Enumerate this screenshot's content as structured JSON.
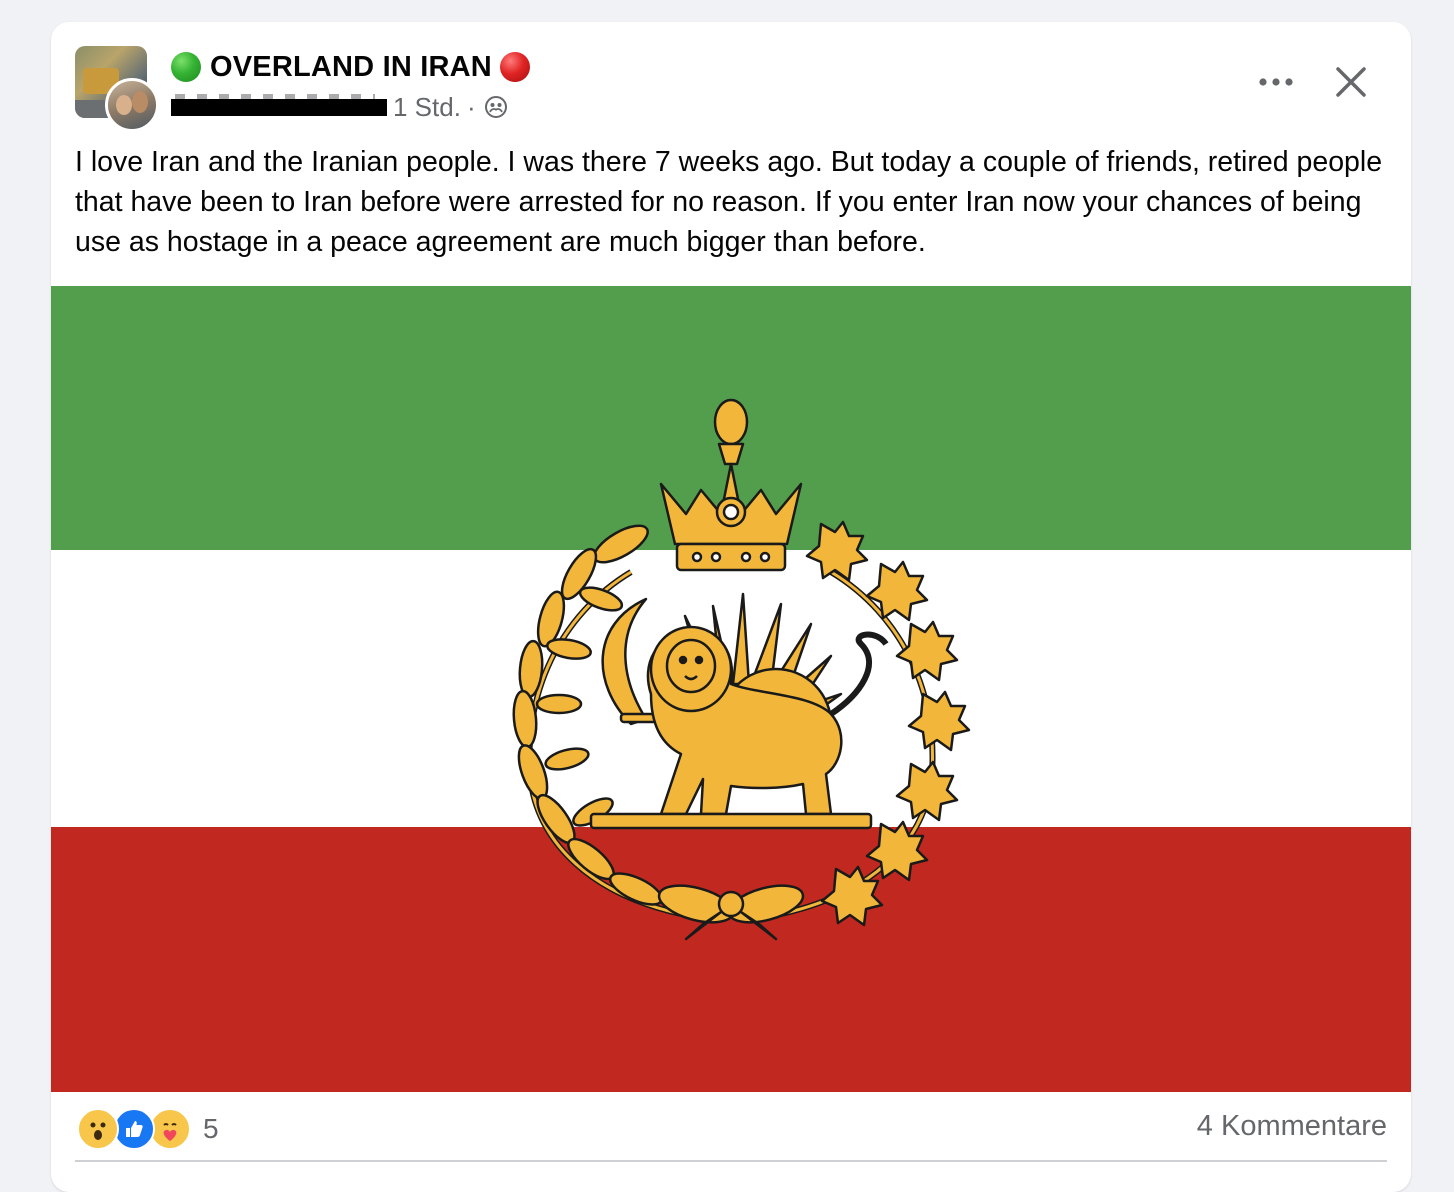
{
  "post": {
    "group_name": "OVERLAND IN IRAN",
    "time": "1 Std.",
    "separator": "·",
    "audience_icon": "group-members-icon",
    "text": "I love Iran and the Iranian people. I was there 7 weeks ago. But today a couple of friends, retired people that have been to Iran before were arrested for no reason. If you enter Iran now your chances of being use as hostage in a peace agreement are much bigger than before."
  },
  "header_actions": {
    "more_icon": "more-options-icon",
    "close_icon": "close-icon"
  },
  "image": {
    "description_icon": "flag-lion-and-sun-emblem",
    "colors": {
      "green": "#529e4d",
      "white": "#ffffff",
      "red": "#c1281f",
      "gold": "#f2b73a"
    }
  },
  "footer": {
    "reactions": [
      "wow",
      "like",
      "care"
    ],
    "reaction_count": "5",
    "comments_label": "4 Kommentare"
  }
}
